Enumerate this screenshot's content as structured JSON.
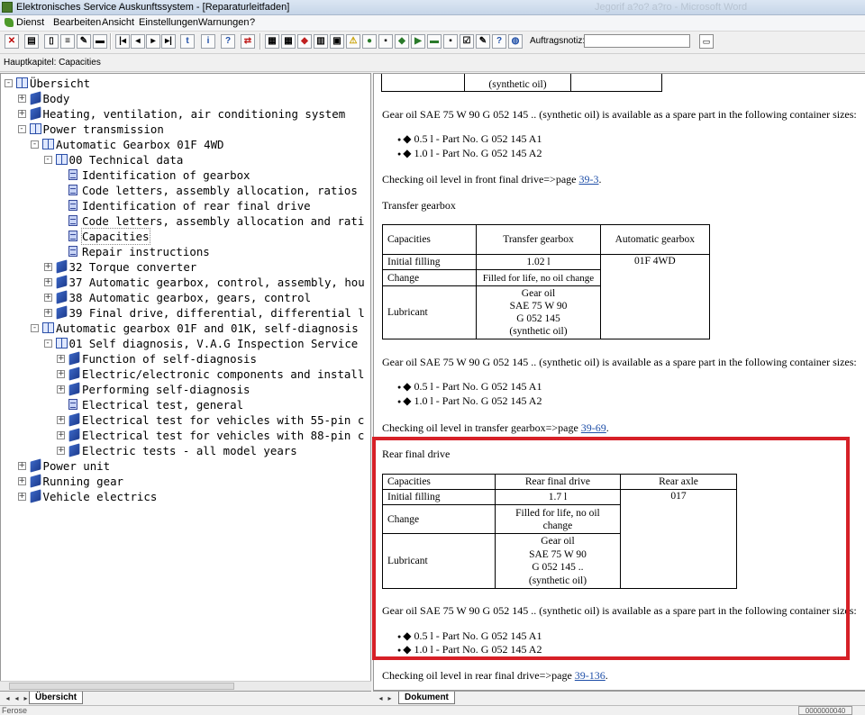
{
  "window": {
    "title": "Elektronisches Service Auskunftssystem - [Reparaturleitfaden]",
    "title_background": "Jegorif a?o? a?ro - Microsoft Word"
  },
  "menu": [
    "Dienst",
    "Bearbeiten",
    "Ansicht",
    "Einstellungen",
    "Warnungen",
    "?"
  ],
  "toolbar": {
    "order_note_label": "Auftragsnotiz:",
    "order_note_value": ""
  },
  "chapter": {
    "label": "Hauptkapitel: Capacities"
  },
  "tree": [
    {
      "label": "Übersicht",
      "icon": "book-open-icon"
    },
    {
      "label": "Body",
      "icon": "book-icon"
    },
    {
      "label": "Heating, ventilation, air conditioning system",
      "icon": "book-icon"
    },
    {
      "label": "Power transmission",
      "icon": "book-open-icon"
    },
    {
      "label": "Automatic Gearbox 01F 4WD",
      "icon": "book-open-icon"
    },
    {
      "label": "00 Technical data",
      "icon": "book-open-icon"
    },
    {
      "label": "Identification of gearbox",
      "icon": "document-icon"
    },
    {
      "label": "Code letters, assembly allocation, ratios",
      "icon": "document-icon"
    },
    {
      "label": "Identification of rear final drive",
      "icon": "document-icon"
    },
    {
      "label": "Code letters, assembly allocation and rati",
      "icon": "document-icon"
    },
    {
      "label": "Capacities",
      "icon": "document-icon"
    },
    {
      "label": "Repair instructions",
      "icon": "document-icon"
    },
    {
      "label": "32 Torque converter",
      "icon": "book-icon"
    },
    {
      "label": "37 Automatic gearbox, control, assembly, hou",
      "icon": "book-icon"
    },
    {
      "label": "38 Automatic gearbox, gears, control",
      "icon": "book-icon"
    },
    {
      "label": "39 Final drive, differential, differential l",
      "icon": "book-icon"
    },
    {
      "label": "Automatic gearbox 01F and 01K, self-diagnosis",
      "icon": "book-open-icon"
    },
    {
      "label": "01 Self diagnosis, V.A.G Inspection Service",
      "icon": "book-open-icon"
    },
    {
      "label": "Function of self-diagnosis",
      "icon": "book-icon"
    },
    {
      "label": "Electric/electronic components and install",
      "icon": "book-icon"
    },
    {
      "label": "Performing self-diagnosis",
      "icon": "book-icon"
    },
    {
      "label": "Electrical test, general",
      "icon": "document-icon"
    },
    {
      "label": "Electrical test for vehicles with 55-pin c",
      "icon": "book-icon"
    },
    {
      "label": "Electrical test for vehicles with 88-pin c",
      "icon": "book-icon"
    },
    {
      "label": "Electric tests - all model years",
      "icon": "book-icon"
    },
    {
      "label": "Power unit",
      "icon": "book-icon"
    },
    {
      "label": "Running gear",
      "icon": "book-icon"
    },
    {
      "label": "Vehicle electrics",
      "icon": "book-icon"
    }
  ],
  "tabs": {
    "tree_tab": "Übersicht",
    "doc_tab": "Dokument"
  },
  "status": {
    "left": "Ferose",
    "right": "0000000040"
  },
  "doc": {
    "top_table_cell": "(synthetic oil)",
    "front_oil_text": "Gear oil SAE 75 W 90 G 052 145 .. (synthetic oil) is available as a spare part in the following container sizes:",
    "front_bullets": [
      "0.5 l - Part No. G 052 145 A1",
      "1.0 l - Part No. G 052 145 A2"
    ],
    "front_check_text": "Checking oil level in front final drive=>page ",
    "front_check_link": "39-3",
    "transfer_heading": "Transfer gearbox",
    "transfer_table": {
      "h_capacities": "Capacities",
      "h_col": "Transfer gearbox",
      "h_auto": "Automatic gearbox",
      "r1_label": "Initial filling",
      "r1_val": "1.02 l",
      "auto_val": "01F 4WD",
      "r2_label": "Change",
      "r2_val": "Filled for life, no oil change",
      "r3_label": "Lubricant",
      "r3_val": [
        "Gear oil",
        "SAE 75 W 90",
        "G 052 145",
        "(synthetic oil)"
      ]
    },
    "transfer_oil_text": "Gear oil SAE 75 W 90 G 052 145 .. (synthetic oil) is available as a spare part in the following container sizes:",
    "transfer_bullets": [
      "0.5 l - Part No. G 052 145 A1",
      "1.0 l - Part No. G 052 145 A2"
    ],
    "transfer_check_text": "Checking oil level in transfer gearbox=>page ",
    "transfer_check_link": "39-69",
    "rear_heading": "Rear final drive",
    "rear_table": {
      "h_capacities": "Capacities",
      "h_col": "Rear final drive",
      "h_axle": "Rear axle",
      "r1_label": "Initial filling",
      "r1_val": "1.7 l",
      "axle_val": "017",
      "r2_label": "Change",
      "r2_val": [
        "Filled for life, no oil",
        "change"
      ],
      "r3_label": "Lubricant",
      "r3_val": [
        "Gear oil",
        "SAE 75 W 90",
        "G 052 145 ..",
        "(synthetic oil)"
      ]
    },
    "rear_oil_text": "Gear oil SAE 75 W 90 G 052 145 .. (synthetic oil) is available as a spare part in the following container sizes:",
    "rear_bullets": [
      "0.5 l - Part No. G 052 145 A1",
      "1.0 l - Part No. G 052 145 A2"
    ],
    "rear_check_text": "Checking oil level in rear final drive=>page ",
    "rear_check_link": "39-136"
  },
  "highlight_color": "#d62027"
}
